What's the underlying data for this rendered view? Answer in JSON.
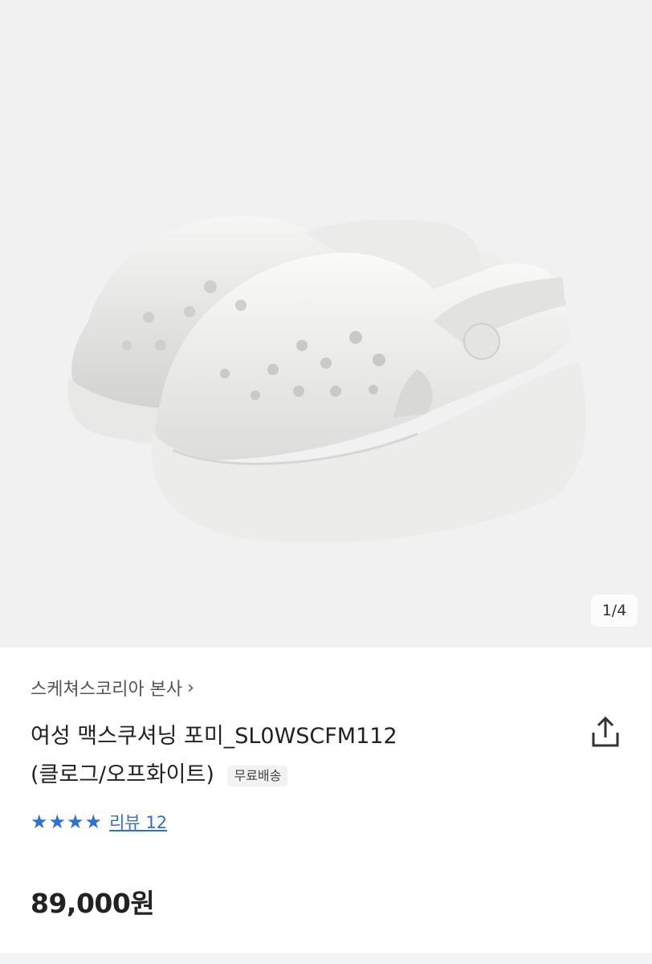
{
  "gallery": {
    "counter": "1/4",
    "image_alt": "white clogs product photo"
  },
  "product": {
    "brand": "스케쳐스코리아 본사",
    "title_line1": "여성 맥스쿠셔닝 포미_SL0WSCFM112",
    "title_line2": "(클로그/오프화이트)",
    "badge": "무료배송",
    "review_label": "리뷰 12",
    "rating_stars": 4,
    "price": "89,000원"
  },
  "colors": {
    "accent": "#2f6fd6",
    "background_hero": "#f1f1f1"
  },
  "icons": [
    "chevron-right-icon",
    "share-icon",
    "star-icon"
  ]
}
